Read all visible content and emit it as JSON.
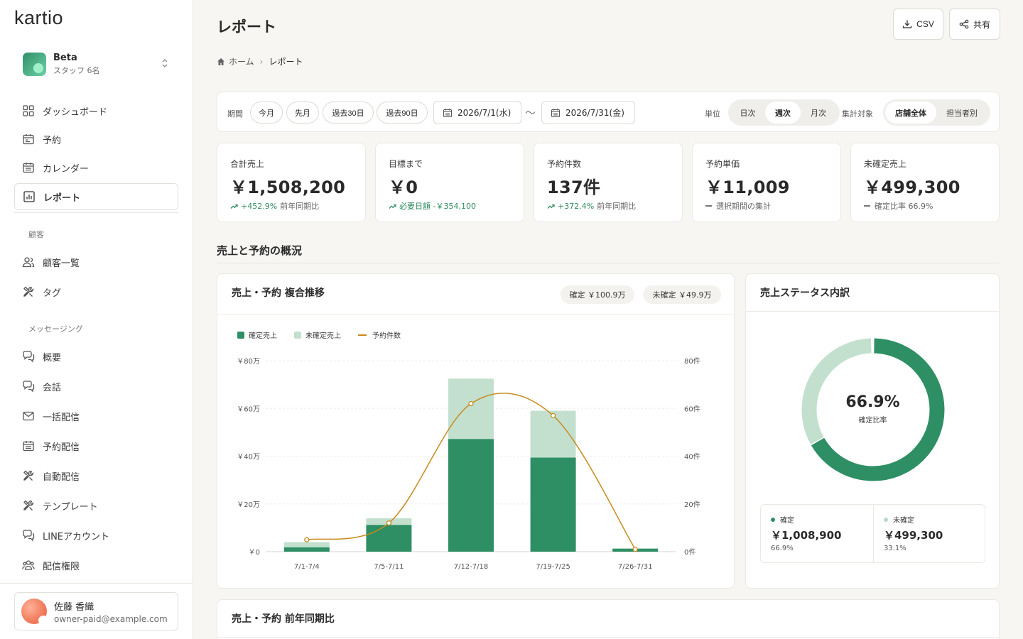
{
  "app": {
    "logo": "kartio"
  },
  "workspace": {
    "name": "Beta",
    "sub": "スタッフ 6名"
  },
  "nav": {
    "dashboard": "ダッシュボード",
    "booking": "予約",
    "calendar": "カレンダー",
    "report": "レポート",
    "section_customer": "顧客",
    "customers": "顧客一覧",
    "tags": "タグ",
    "section_messaging": "メッセージング",
    "overview": "概要",
    "conversations": "会話",
    "broadcast": "一括配信",
    "scheduled": "予約配信",
    "auto": "自動配信",
    "templates": "テンプレート",
    "line": "LINEアカウント",
    "permissions": "配信権限"
  },
  "user": {
    "name": "佐藤 香織",
    "email": "owner-paid@example.com"
  },
  "header": {
    "title": "レポート",
    "csv": "CSV",
    "share": "共有"
  },
  "breadcrumb": {
    "home": "ホーム",
    "current": "レポート"
  },
  "filter": {
    "period_label": "期間",
    "chips": [
      "今月",
      "先月",
      "過去30日",
      "過去90日"
    ],
    "date_from": "2026/7/1(水)",
    "tilde": "〜",
    "date_to": "2026/7/31(金)",
    "unit_label": "単位",
    "units": [
      "日次",
      "週次",
      "月次"
    ],
    "target_label": "集計対象",
    "targets": [
      "店舗全体",
      "担当者別"
    ]
  },
  "kpis": [
    {
      "title": "合計売上",
      "value": "￥1,508,200",
      "delta": "+452.9%",
      "note": "前年同期比"
    },
    {
      "title": "目標まで",
      "value": "￥0",
      "delta": "必要日額 -￥354,100",
      "note": ""
    },
    {
      "title": "予約件数",
      "value": "137件",
      "delta": "+372.4%",
      "note": "前年同期比"
    },
    {
      "title": "予約単価",
      "value": "￥11,009",
      "note": "選択期間の集計"
    },
    {
      "title": "未確定売上",
      "value": "￥499,300",
      "note": "確定比率 66.9%"
    }
  ],
  "section": {
    "overview": "売上と予約の概況"
  },
  "combo": {
    "title": "売上・予約 複合推移",
    "pill_confirmed": "確定 ￥100.9万",
    "pill_pending": "未確定 ￥49.9万"
  },
  "colors": {
    "confirmed": "#2e8f64",
    "pending": "#c3e0cf",
    "bookings": "#c98a1c"
  },
  "chart_data": {
    "type": "bar",
    "categories": [
      "7/1-7/4",
      "7/5-7/11",
      "7/12-7/18",
      "7/19-7/25",
      "7/26-7/31"
    ],
    "series": [
      {
        "name": "確定売上",
        "values": [
          18000,
          112000,
          472000,
          394000,
          12900
        ]
      },
      {
        "name": "未確定売上",
        "values": [
          22000,
          28000,
          253000,
          196300,
          0
        ]
      },
      {
        "name": "予約件数",
        "values": [
          5,
          12,
          62,
          57,
          1
        ]
      }
    ],
    "y_left_ticks": [
      "￥0",
      "￥20万",
      "￥40万",
      "￥60万",
      "￥80万"
    ],
    "y_right_ticks": [
      "0件",
      "20件",
      "40件",
      "60件",
      "80件"
    ],
    "ylim": [
      0,
      800000
    ],
    "ylim_right": [
      0,
      80
    ]
  },
  "status": {
    "title": "売上ステータス内訳",
    "ratio": "66.9%",
    "ratio_label": "確定比率",
    "confirmed_label": "確定",
    "confirmed_value": "￥1,008,900",
    "confirmed_pct": "66.9%",
    "pending_label": "未確定",
    "pending_value": "￥499,300",
    "pending_pct": "33.1%",
    "confirmed_fraction": 0.669
  },
  "yoy": {
    "title": "売上・予約 前年同期比"
  }
}
